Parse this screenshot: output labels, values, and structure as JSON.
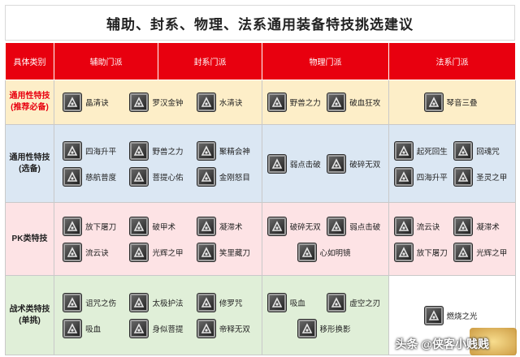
{
  "title": "辅助、封系、物理、法系通用装备特技挑选建议",
  "header": {
    "category": "具体类别",
    "support": "辅助门派",
    "seal": "封系门派",
    "physical": "物理门派",
    "magic": "法系门派"
  },
  "rows": {
    "general": {
      "label_line1": "通用性特技",
      "label_line2": "(推荐必备)",
      "support_seal": [
        "晶清诀",
        "罗汉金钟",
        "水清诀"
      ],
      "physical": [
        "野兽之力",
        "破血狂攻"
      ],
      "magic": [
        "琴音三叠"
      ]
    },
    "optional": {
      "label_line1": "通用性特技",
      "label_line2": "(选备)",
      "support_seal": [
        "四海升平",
        "野兽之力",
        "聚精会神",
        "慈航普度",
        "菩提心佑",
        "金刚怒目"
      ],
      "physical": [
        "弱点击破",
        "破碎无双"
      ],
      "magic": [
        "起死回生",
        "回魂咒",
        "四海升平",
        "圣灵之甲"
      ]
    },
    "pk": {
      "label_line1": "PK类特技",
      "support_seal": [
        "放下屠刀",
        "破甲术",
        "凝滞术",
        "流云诀",
        "光辉之甲",
        "笑里藏刀"
      ],
      "physical": [
        "破碎无双",
        "弱点击破",
        "心如明镜"
      ],
      "magic": [
        "流云诀",
        "凝滞术",
        "放下屠刀",
        "光辉之甲"
      ]
    },
    "tactic": {
      "label_line1": "战术类特技",
      "label_line2": "(单挑)",
      "support_seal": [
        "诅咒之伤",
        "太极护法",
        "修罗咒",
        "吸血",
        "身似菩提",
        "帝释无双"
      ],
      "physical": [
        "吸血",
        "虚空之刃",
        "移形换影"
      ],
      "magic": [
        "燃烧之光"
      ]
    }
  },
  "watermark": "头条 @侠客小贱贱",
  "colors": {
    "header_red": "#e8000f",
    "general_bg": "#fdeec8",
    "optional_bg": "#dbe7f3",
    "pk_bg": "#fde3e5",
    "tactic_bg": "#e0efd8"
  }
}
